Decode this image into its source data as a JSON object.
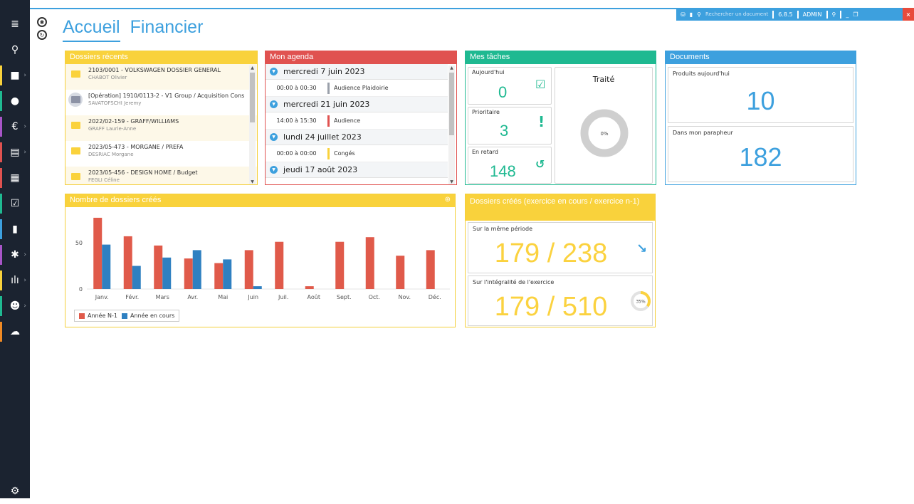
{
  "topbar": {
    "search_placeholder": "Rechercher un document",
    "version": "6.8.5",
    "user": "ADMIN",
    "close_glyph": "×"
  },
  "tabs": [
    {
      "label": "Accueil",
      "active": true
    },
    {
      "label": "Financier",
      "active": false
    }
  ],
  "sidebar": {
    "items": [
      {
        "icon": "collapse-icon",
        "glyph": "≣",
        "color": "#1b2330"
      },
      {
        "icon": "search-icon",
        "glyph": "⚲",
        "color": "#1b2330"
      },
      {
        "icon": "folder-icon",
        "glyph": "■",
        "color": "#f9d23c",
        "chev": true
      },
      {
        "icon": "user-icon",
        "glyph": "●",
        "color": "#1fb991"
      },
      {
        "icon": "euro-icon",
        "glyph": "€",
        "color": "#a855c8",
        "chev": true
      },
      {
        "icon": "document-icon",
        "glyph": "▤",
        "color": "#e05250",
        "chev": true
      },
      {
        "icon": "calendar-icon",
        "glyph": "▦",
        "color": "#e05250"
      },
      {
        "icon": "task-icon",
        "glyph": "☑",
        "color": "#1fb991"
      },
      {
        "icon": "bookmark-icon",
        "glyph": "▮",
        "color": "#3da0de"
      },
      {
        "icon": "plugin-icon",
        "glyph": "✱",
        "color": "#a855c8",
        "chev": true
      },
      {
        "icon": "stats-icon",
        "glyph": "ılı",
        "color": "#f9d23c",
        "chev": true
      },
      {
        "icon": "contacts-icon",
        "glyph": "☻",
        "color": "#1fb991",
        "chev": true
      },
      {
        "icon": "cloud-icon",
        "glyph": "☁",
        "color": "#f08a24"
      }
    ],
    "settings_glyph": "⚙"
  },
  "dossiers": {
    "title": "Dossiers récents",
    "items": [
      {
        "title": "2103/0001 - VOLKSWAGEN DOSSIER GENERAL",
        "sub": "CHABOT Olivier",
        "grey": false
      },
      {
        "title": "[Opération] 1910/0113-2 - V1 Group / Acquisition Cons",
        "sub": "SAVATOFSCHI Jeremy",
        "grey": true
      },
      {
        "title": "2022/02-159 - GRAFF/WILLIAMS",
        "sub": "GRAFF Laurie-Anne",
        "grey": false
      },
      {
        "title": "2023/05-473 - MORGANE / PREFA",
        "sub": "DESRIAC Morgane",
        "grey": false
      },
      {
        "title": "2023/05-456 - DESIGN HOME / Budget",
        "sub": "FEGLI Céline",
        "grey": false
      }
    ]
  },
  "agenda": {
    "title": "Mon agenda",
    "days": [
      {
        "date": "mercredi 7 juin 2023",
        "events": [
          {
            "time": "00:00 à 00:30",
            "label": "Audience Plaidoirie",
            "color": "#9aa0aa"
          }
        ]
      },
      {
        "date": "mercredi 21 juin 2023",
        "events": [
          {
            "time": "14:00 à 15:30",
            "label": "Audience",
            "color": "#e05250"
          }
        ]
      },
      {
        "date": "lundi 24 juillet 2023",
        "events": [
          {
            "time": "00:00 à 00:00",
            "label": "Congés",
            "color": "#f9d23c"
          }
        ]
      },
      {
        "date": "jeudi 17 août 2023",
        "events": []
      }
    ]
  },
  "tasks": {
    "title": "Mes tâches",
    "today_label": "Aujourd'hui",
    "today_value": "0",
    "priority_label": "Prioritaire",
    "priority_value": "3",
    "late_label": "En retard",
    "late_value": "148",
    "done_label": "Traité",
    "done_percent": "0%",
    "done_fraction": 0
  },
  "documents": {
    "title": "Documents",
    "today_label": "Produits aujourd'hui",
    "today_value": "10",
    "parapheur_label": "Dans mon parapheur",
    "parapheur_value": "182"
  },
  "comparison": {
    "title": "Dossiers créés (exercice en cours / exercice n-1)",
    "period_label": "Sur la même période",
    "period_value": "179 / 238",
    "year_label": "Sur l'intégralité de l'exercice",
    "year_value": "179 / 510",
    "year_percent": "35%",
    "year_fraction": 0.35,
    "trend_glyph": "↘"
  },
  "chart_data": {
    "type": "bar",
    "title": "Nombre de dossiers créés",
    "categories": [
      "Janv.",
      "Févr.",
      "Mars",
      "Avr.",
      "Mai",
      "Juin",
      "Juil.",
      "Août",
      "Sept.",
      "Oct.",
      "Nov.",
      "Déc."
    ],
    "series": [
      {
        "name": "Année N-1",
        "color": "#e05a4a",
        "values": [
          77,
          57,
          47,
          33,
          28,
          42,
          51,
          3,
          51,
          56,
          36,
          42
        ]
      },
      {
        "name": "Année en cours",
        "color": "#2f80c1",
        "values": [
          48,
          25,
          34,
          42,
          32,
          3,
          0,
          0,
          0,
          0,
          0,
          0
        ]
      }
    ],
    "yticks": [
      0,
      50
    ],
    "ylim": [
      0,
      80
    ],
    "legend": "bottom-left"
  }
}
